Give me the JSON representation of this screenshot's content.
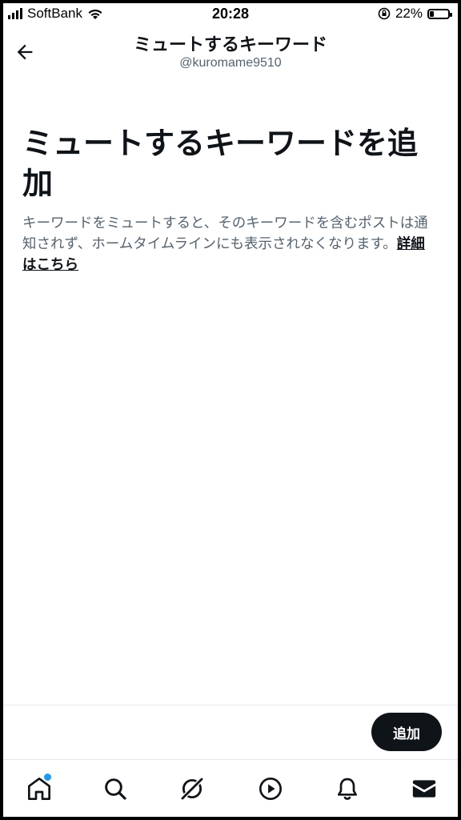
{
  "status_bar": {
    "carrier": "SoftBank",
    "time": "20:28",
    "battery_percent_label": "22%",
    "battery_level": 0.22
  },
  "header": {
    "title": "ミュートするキーワード",
    "username": "@kuromame9510",
    "back_icon": "back-arrow-icon"
  },
  "main": {
    "heading": "ミュートするキーワードを追加",
    "description": "キーワードをミュートすると、そのキーワードを含むポストは通知されず、ホームタイムラインにも表示されなくなります。",
    "link_label": "詳細はこちら"
  },
  "footer": {
    "add_button_label": "追加"
  },
  "tab_bar": {
    "items": [
      "home-icon",
      "search-icon",
      "grok-icon",
      "play-icon",
      "notifications-icon",
      "messages-icon"
    ],
    "home_has_badge": true,
    "badge_color": "#1d9bf0"
  },
  "colors": {
    "text": "#0f1419",
    "secondary": "#536471",
    "accent": "#1d9bf0"
  }
}
